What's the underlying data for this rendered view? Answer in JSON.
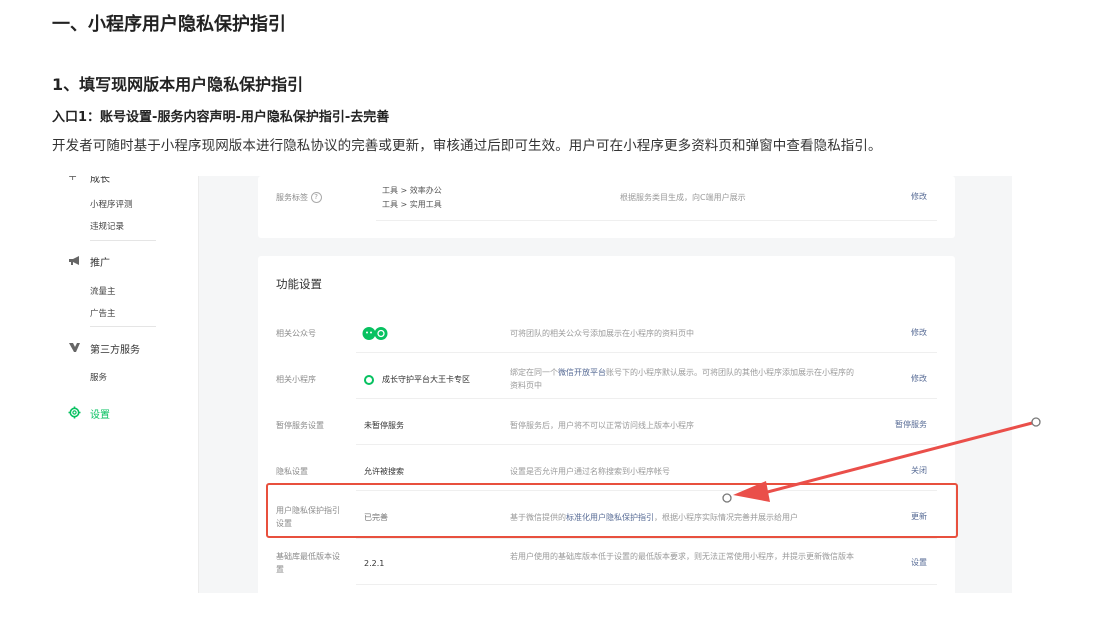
{
  "doc": {
    "h1": "一、小程序用户隐私保护指引",
    "h2": "1、填写现网版本用户隐私保护指引",
    "h3": "入口1：账号设置-服务内容声明-用户隐私保护指引-去完善",
    "para": "开发者可随时基于小程序现网版本进行隐私协议的完善或更新，审核通过后即可生效。用户可在小程序更多资料页和弹窗中查看隐私指引。"
  },
  "sidebar": {
    "top_partial": "成长",
    "growth_items": [
      "小程序评测",
      "违规记录"
    ],
    "promote_label": "推广",
    "promote_items": [
      "流量主",
      "广告主"
    ],
    "third_party_label": "第三方服务",
    "third_party_items": [
      "服务"
    ],
    "settings_label": "设置"
  },
  "card1": {
    "label": "服务标签",
    "value_line1": "工具 > 效率办公",
    "value_line2": "工具 > 实用工具",
    "desc": "根据服务类目生成，向C端用户展示",
    "action": "修改"
  },
  "card2": {
    "title": "功能设置",
    "rows": [
      {
        "label": "相关公众号",
        "value": "",
        "desc": "可将团队的相关公众号添加展示在小程序的资料页中",
        "action": "修改"
      },
      {
        "label": "相关小程序",
        "value": "成长守护平台大王卡专区",
        "desc_pre": "绑定在同一个",
        "desc_link": "微信开放平台",
        "desc_post": "账号下的小程序默认展示。可将团队的其他小程序添加展示在小程序的资料页中",
        "action": "修改"
      },
      {
        "label": "暂停服务设置",
        "value": "未暂停服务",
        "desc": "暂停服务后，用户将不可以正常访问线上版本小程序",
        "action": "暂停服务"
      },
      {
        "label": "隐私设置",
        "value": "允许被搜索",
        "desc": "设置是否允许用户通过名称搜索到小程序帐号",
        "action": "关闭"
      },
      {
        "label_line1": "用户隐私保护指引",
        "label_line2": "设置",
        "value": "已完善",
        "desc_pre": "基于微信提供的",
        "desc_link": "标准化用户隐私保护指引",
        "desc_post": "，根据小程序实际情况完善并展示给用户",
        "action": "更新"
      },
      {
        "label_line1": "基础库最低版本设",
        "label_line2": "置",
        "value": "2.2.1",
        "desc": "若用户使用的基础库版本低于设置的最低版本要求，则无法正常使用小程序，并提示更新微信版本",
        "action": "设置"
      }
    ]
  },
  "colors": {
    "accent_green": "#07c160",
    "link": "#576b95",
    "highlight_red": "#e8503e"
  },
  "icons": [
    "megaphone-icon",
    "third-party-icon",
    "gear-icon",
    "help-circle-icon",
    "wechat-icon",
    "miniprogram-icon"
  ]
}
